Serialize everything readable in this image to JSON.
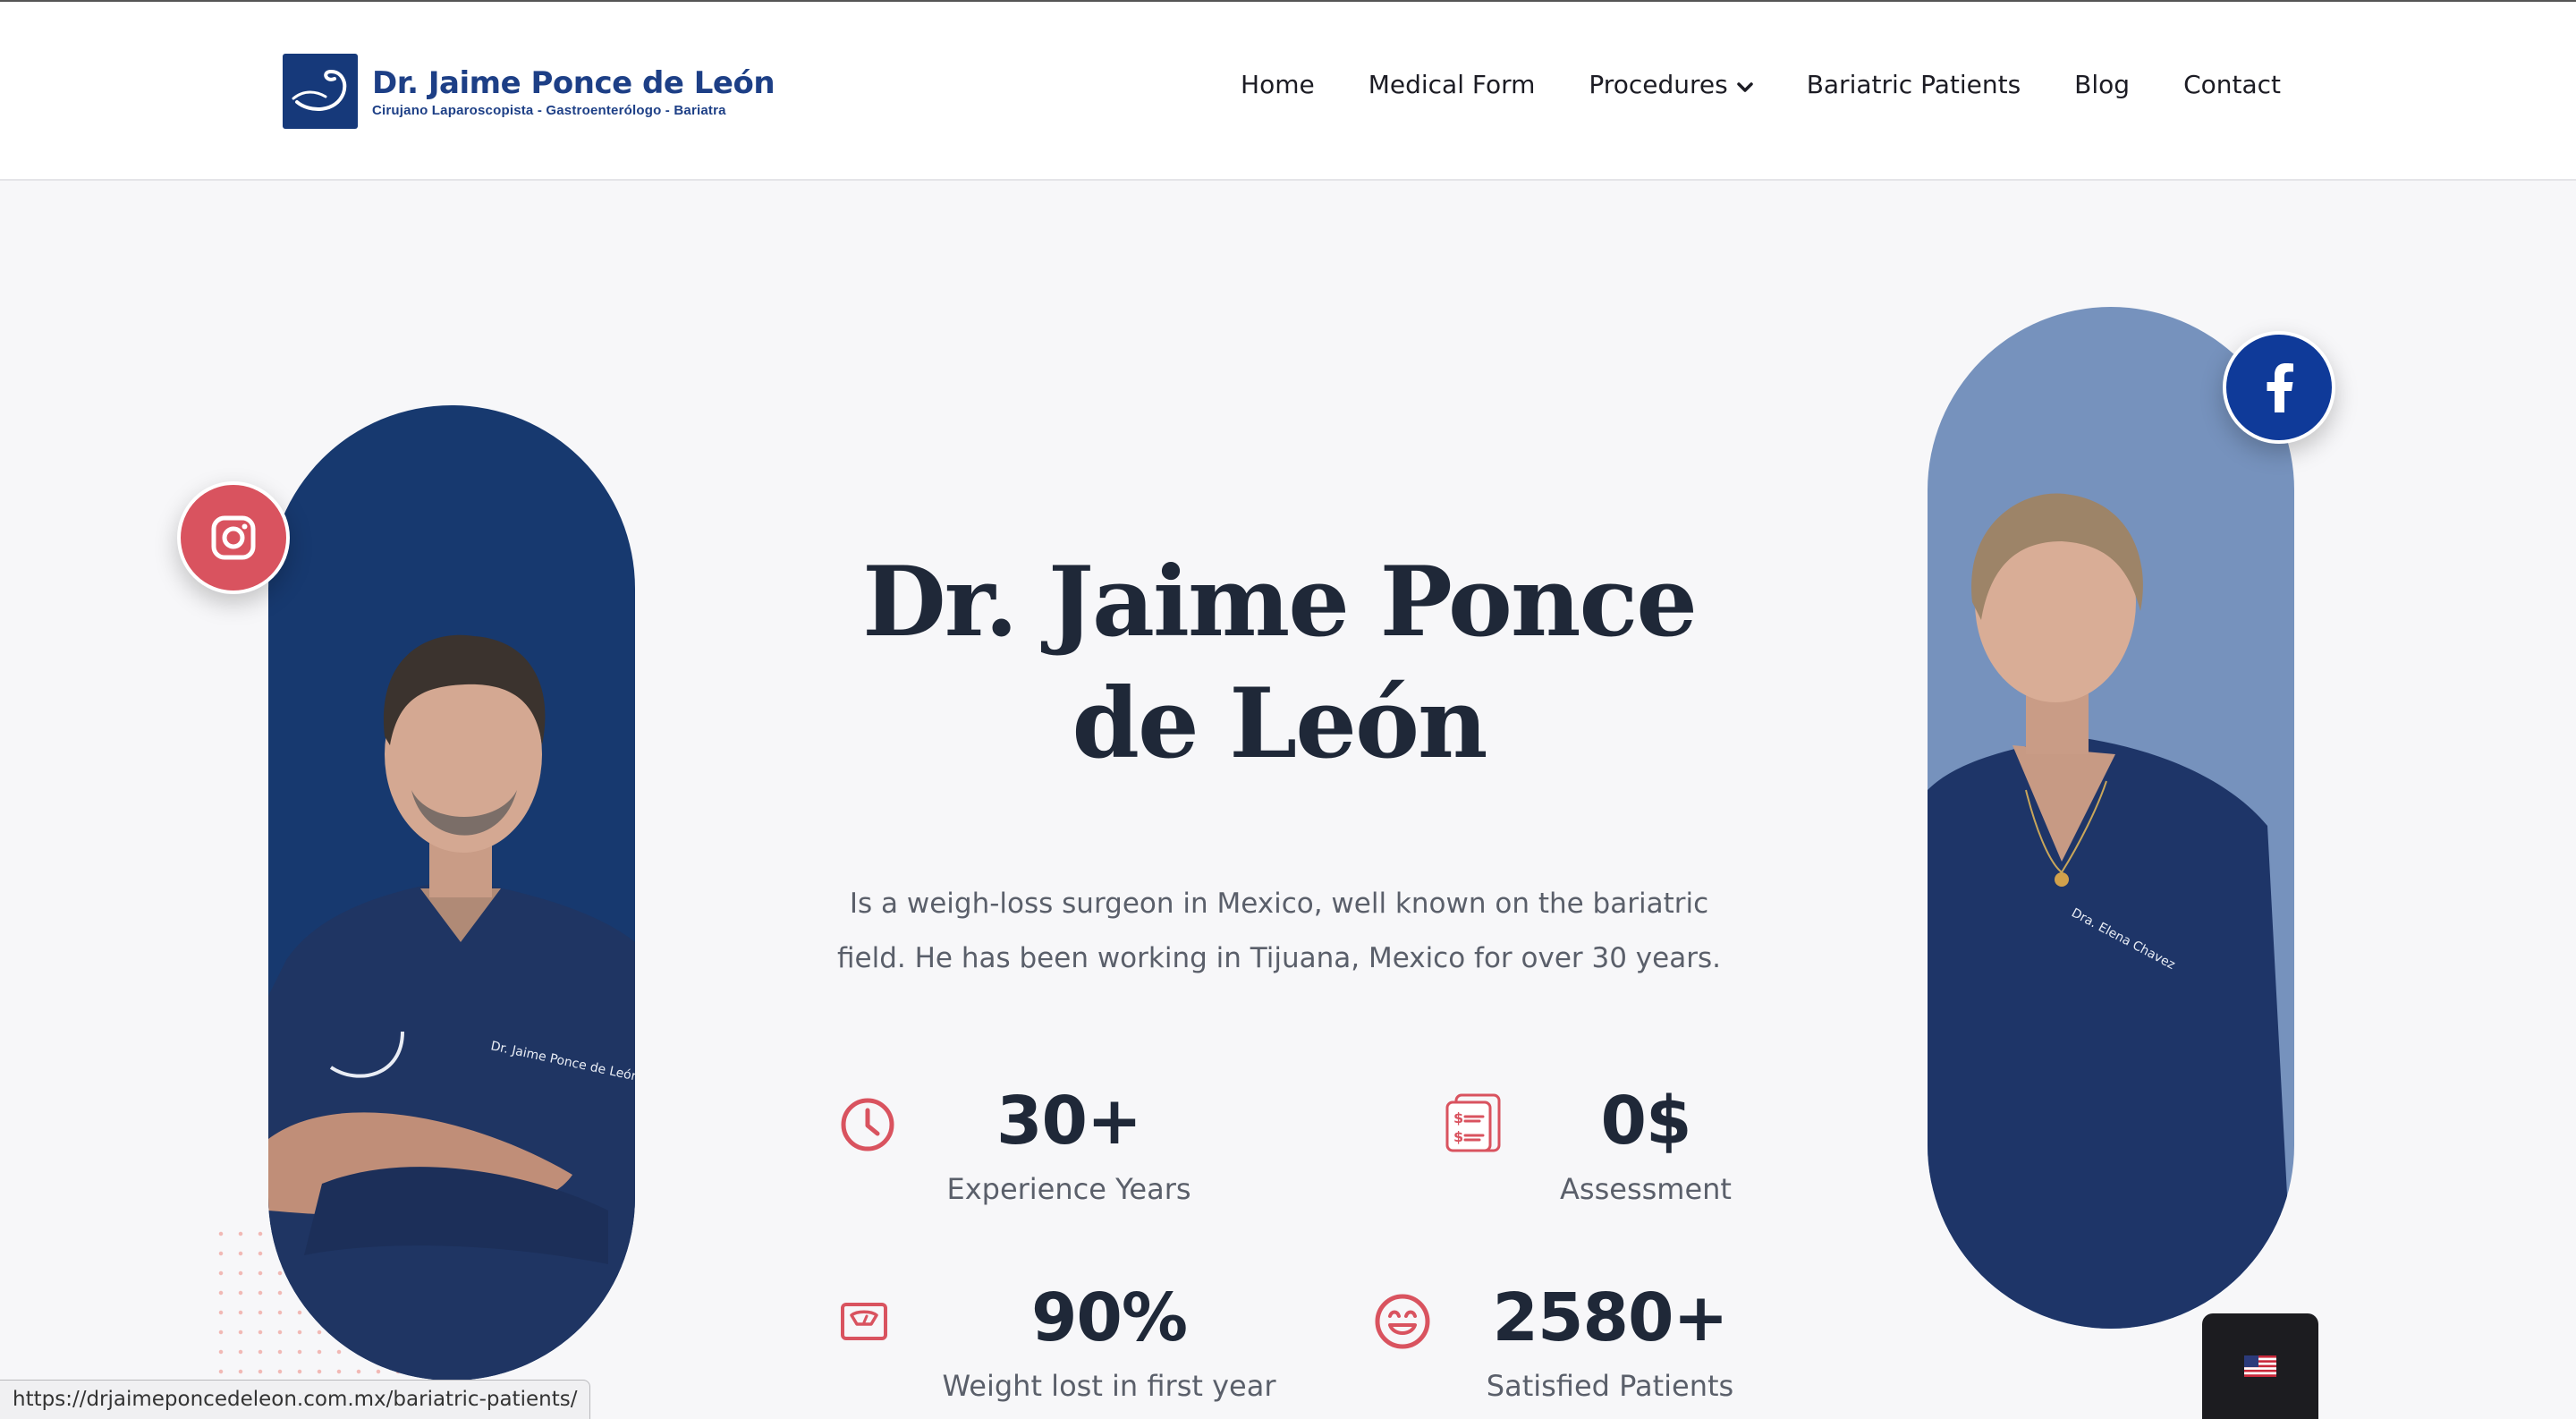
{
  "header": {
    "logo_title": "Dr. Jaime Ponce de León",
    "logo_subtitle": "Cirujano Laparoscopista - Gastroenterólogo - Bariatra",
    "nav": [
      {
        "label": "Home"
      },
      {
        "label": "Medical Form"
      },
      {
        "label": "Procedures",
        "has_dropdown": true
      },
      {
        "label": "Bariatric Patients"
      },
      {
        "label": "Blog"
      },
      {
        "label": "Contact"
      }
    ]
  },
  "hero": {
    "title": "Dr. Jaime Ponce de León",
    "description": "Is a weigh-loss surgeon in Mexico, well known on the bariatric field. He has been working in Tijuana, Mexico for over 30 years."
  },
  "stats": [
    {
      "value": "30+",
      "label": "Experience Years",
      "icon": "clock-icon"
    },
    {
      "value": "0$",
      "label": "Assessment",
      "icon": "price-list-icon"
    },
    {
      "value": "90%",
      "label": "Weight lost in first year",
      "icon": "scale-icon"
    },
    {
      "value": "2580+",
      "label": "Satisfied Patients",
      "icon": "smile-icon"
    }
  ],
  "social": {
    "instagram_icon": "instagram-icon",
    "facebook_icon": "facebook-icon"
  },
  "status_bar": {
    "url": "https://drjaimeponcedeleon.com.mx/bariatric-patients/"
  },
  "language_switcher": {
    "icon": "us-flag-icon"
  },
  "colors": {
    "brand_navy": "#16397a",
    "accent_red": "#d9535f",
    "facebook_blue": "#0f3a99",
    "pill_left": "#17396f",
    "pill_right": "#7692bd"
  }
}
